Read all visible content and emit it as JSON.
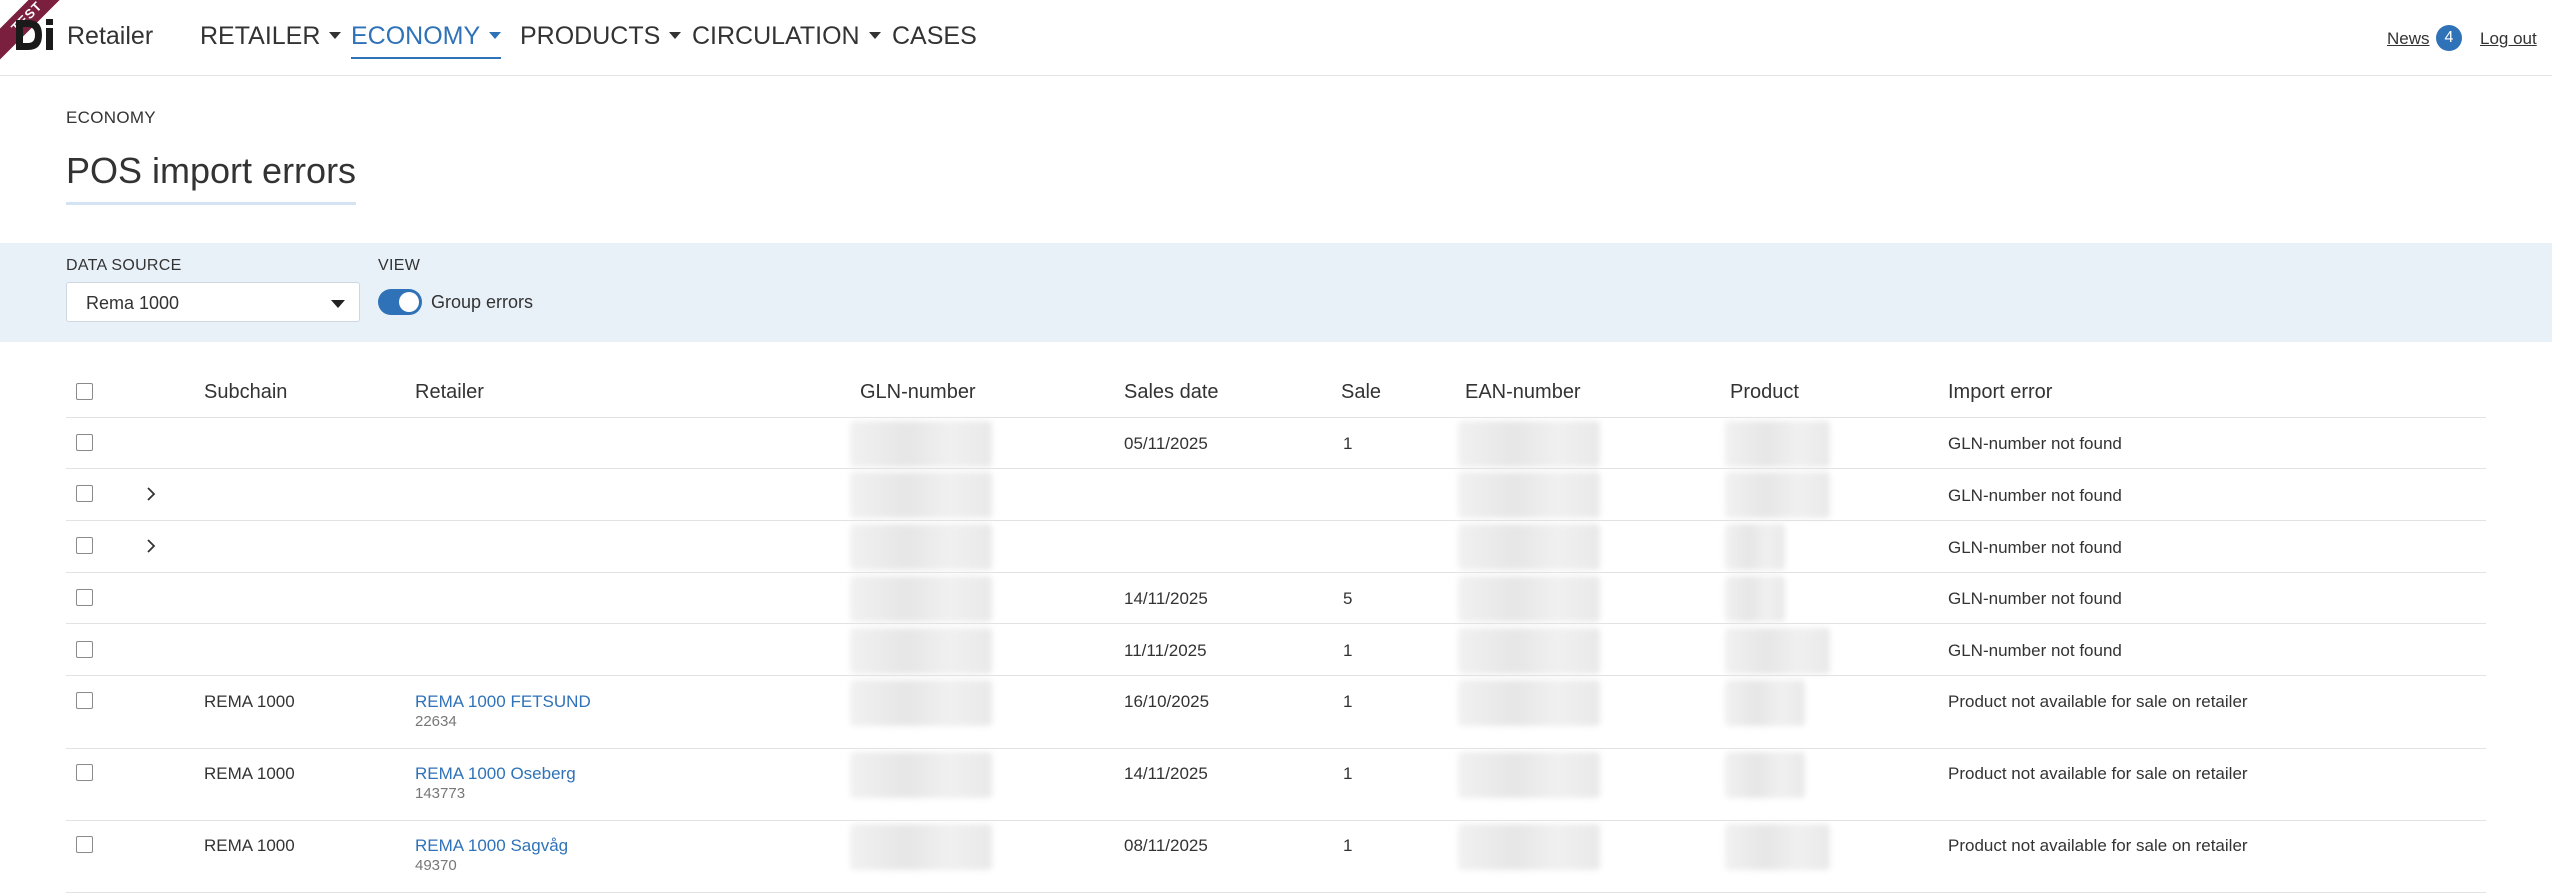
{
  "app": {
    "ribbon": "TEST",
    "logo_text": "Di",
    "name": "Retailer"
  },
  "nav": {
    "items": [
      {
        "label": "RETAILER"
      },
      {
        "label": "ECONOMY"
      },
      {
        "label": "PRODUCTS"
      },
      {
        "label": "CIRCULATION"
      },
      {
        "label": "CASES"
      }
    ],
    "active": "ECONOMY",
    "news_label": "News",
    "news_count": "4",
    "logout_label": "Log out"
  },
  "page": {
    "breadcrumb": "ECONOMY",
    "title": "POS import errors"
  },
  "filters": {
    "data_source_label": "DATA SOURCE",
    "data_source_value": "Rema 1000",
    "view_label": "VIEW",
    "group_errors_label": "Group errors",
    "group_errors_on": true
  },
  "table": {
    "columns": [
      "Subchain",
      "Retailer",
      "GLN-number",
      "Sales date",
      "Sale",
      "EAN-number",
      "Product",
      "Import error"
    ],
    "rows": [
      {
        "expandable": false,
        "subchain": "",
        "retailer": "",
        "retailer_id": "",
        "sales_date": "05/11/2025",
        "sale": "1",
        "import_error": "GLN-number not found"
      },
      {
        "expandable": true,
        "subchain": "",
        "retailer": "",
        "retailer_id": "",
        "sales_date": "",
        "sale": "",
        "import_error": "GLN-number not found"
      },
      {
        "expandable": true,
        "subchain": "",
        "retailer": "",
        "retailer_id": "",
        "sales_date": "",
        "sale": "",
        "import_error": "GLN-number not found"
      },
      {
        "expandable": false,
        "subchain": "",
        "retailer": "",
        "retailer_id": "",
        "sales_date": "14/11/2025",
        "sale": "5",
        "import_error": "GLN-number not found"
      },
      {
        "expandable": false,
        "subchain": "",
        "retailer": "",
        "retailer_id": "",
        "sales_date": "11/11/2025",
        "sale": "1",
        "import_error": "GLN-number not found"
      },
      {
        "expandable": false,
        "subchain": "REMA 1000",
        "retailer": "REMA 1000 FETSUND",
        "retailer_id": "22634",
        "sales_date": "16/10/2025",
        "sale": "1",
        "import_error": "Product not available for sale on retailer"
      },
      {
        "expandable": false,
        "subchain": "REMA 1000",
        "retailer": "REMA 1000 Oseberg",
        "retailer_id": "143773",
        "sales_date": "14/11/2025",
        "sale": "1",
        "import_error": "Product not available for sale on retailer"
      },
      {
        "expandable": false,
        "subchain": "REMA 1000",
        "retailer": "REMA 1000 Sagvåg",
        "retailer_id": "49370",
        "sales_date": "08/11/2025",
        "sale": "1",
        "import_error": "Product not available for sale on retailer"
      }
    ]
  },
  "colors": {
    "accent": "#2f72b8",
    "filter_band": "#e8f0f8",
    "ribbon": "#7a1f3d"
  }
}
